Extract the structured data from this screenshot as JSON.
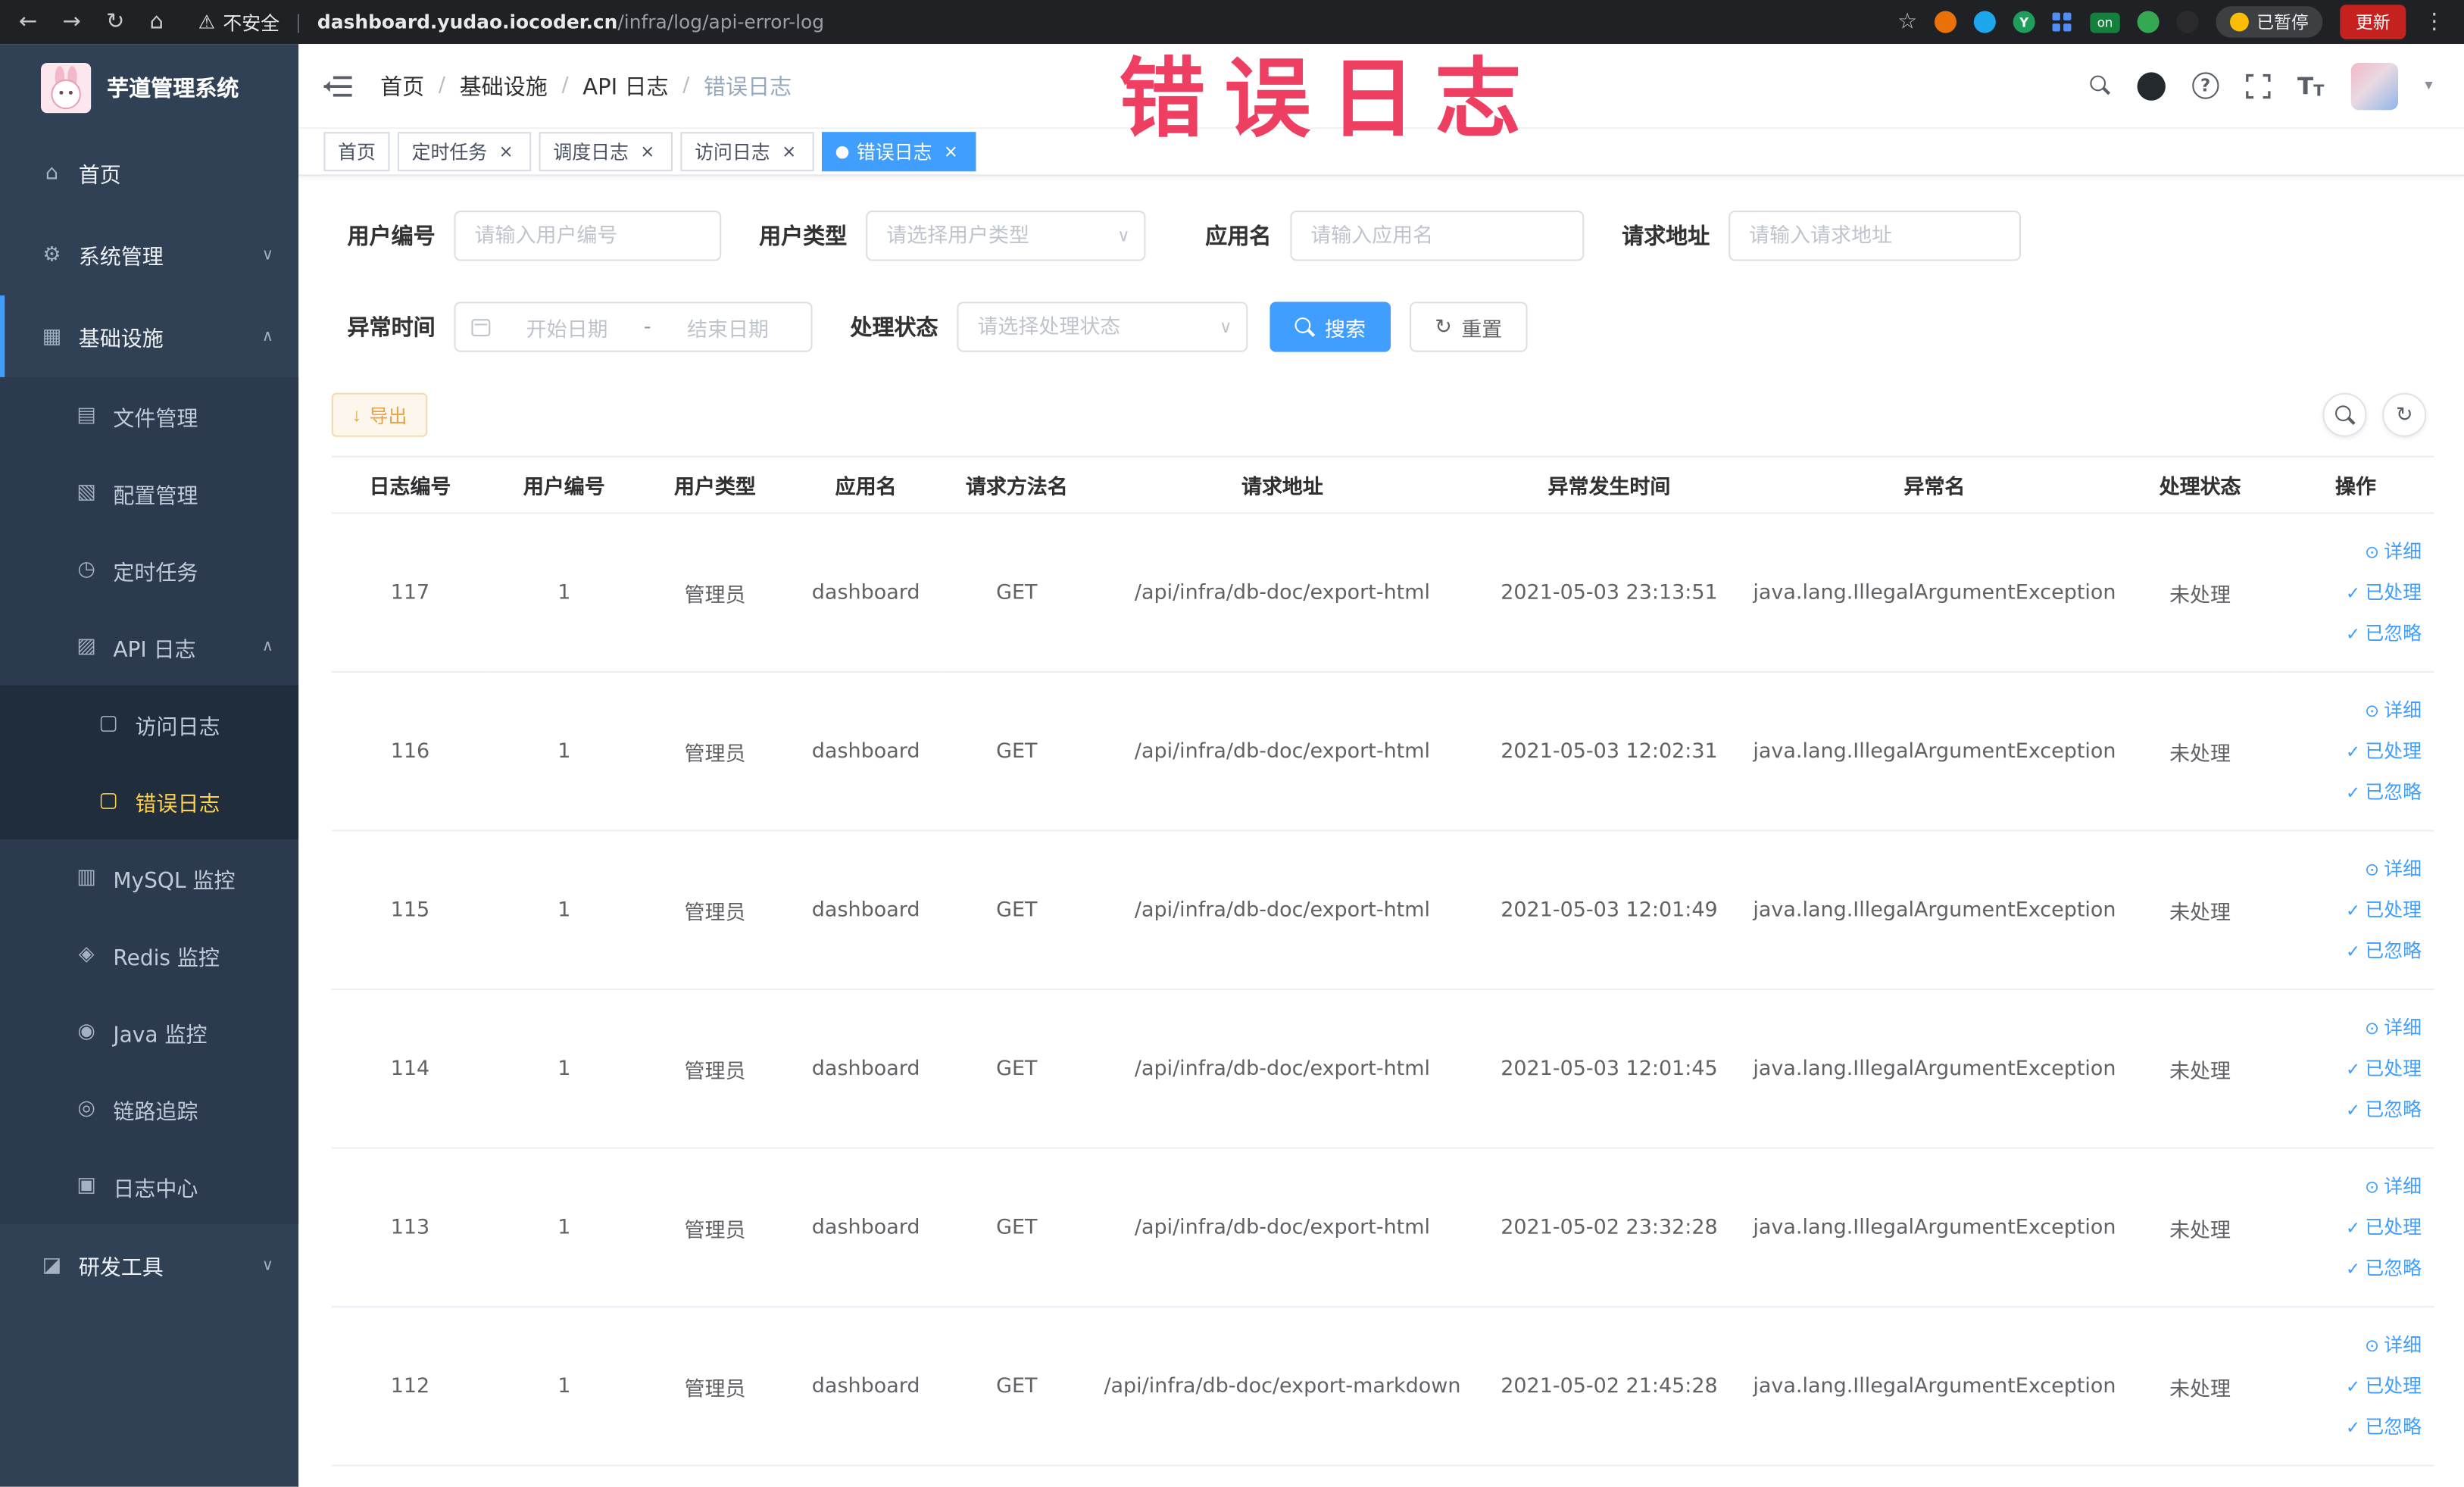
{
  "colors": {
    "accent": "#409eff",
    "sidebar_bg": "#304156",
    "sidebar_submenu_bg": "#1f2d3d",
    "active_menu_text": "#ffd04b",
    "annotation_pink": "#ee3f63",
    "export_text": "#e6a23c",
    "link_blue": "#409eff",
    "active_tab_bg": "#409eff"
  },
  "browser": {
    "security_label": "不安全",
    "separator": "|",
    "url_host": "dashboard.yudao.iocoder.cn",
    "url_path": "/infra/log/api-error-log",
    "paused_badge": "已暂停",
    "update_button": "更新"
  },
  "annotation": {
    "text": "错误日志"
  },
  "sidebar": {
    "logo_title": "芋道管理系统",
    "items": [
      {
        "key": "home",
        "label": "首页",
        "icon": "home-icon",
        "level": 0
      },
      {
        "key": "system-mgmt",
        "label": "系统管理",
        "icon": "gear-icon",
        "level": 0,
        "arrow": "down"
      },
      {
        "key": "infrastructure",
        "label": "基础设施",
        "icon": "infra-icon",
        "level": 0,
        "arrow": "up",
        "section_active": true
      },
      {
        "key": "file-mgmt",
        "label": "文件管理",
        "icon": "file-icon",
        "level": 1
      },
      {
        "key": "config-mgmt",
        "label": "配置管理",
        "icon": "config-icon",
        "level": 1
      },
      {
        "key": "scheduled-jobs",
        "label": "定时任务",
        "icon": "timer-icon",
        "level": 1
      },
      {
        "key": "api-logs",
        "label": "API 日志",
        "icon": "api-log-icon",
        "level": 1,
        "arrow": "up"
      },
      {
        "key": "access-log",
        "label": "访问日志",
        "icon": "doc-icon",
        "level": 2
      },
      {
        "key": "error-log",
        "label": "错误日志",
        "icon": "doc-icon",
        "level": 2,
        "active": true
      },
      {
        "key": "mysql-monitor",
        "label": "MySQL 监控",
        "icon": "mysql-icon",
        "level": 1
      },
      {
        "key": "redis-monitor",
        "label": "Redis 监控",
        "icon": "redis-icon",
        "level": 1
      },
      {
        "key": "java-monitor",
        "label": "Java 监控",
        "icon": "java-icon",
        "level": 1
      },
      {
        "key": "link-trace",
        "label": "链路追踪",
        "icon": "trace-icon",
        "level": 1
      },
      {
        "key": "log-center",
        "label": "日志中心",
        "icon": "log-center-icon",
        "level": 1
      },
      {
        "key": "dev-tools",
        "label": "研发工具",
        "icon": "tools-icon",
        "level": 0,
        "arrow": "down"
      }
    ]
  },
  "breadcrumb": [
    "首页",
    "基础设施",
    "API 日志",
    "错误日志"
  ],
  "breadcrumb_separator": "/",
  "tab_close_glyph": "×",
  "tabs": [
    {
      "label": "首页",
      "closable": false,
      "active": false
    },
    {
      "label": "定时任务",
      "closable": true,
      "active": false
    },
    {
      "label": "调度日志",
      "closable": true,
      "active": false
    },
    {
      "label": "访问日志",
      "closable": true,
      "active": false
    },
    {
      "label": "错误日志",
      "closable": true,
      "active": true
    }
  ],
  "filters": {
    "user_id": {
      "label": "用户编号",
      "placeholder": "请输入用户编号"
    },
    "user_type": {
      "label": "用户类型",
      "placeholder": "请选择用户类型"
    },
    "app_name": {
      "label": "应用名",
      "placeholder": "请输入应用名"
    },
    "request_url": {
      "label": "请求地址",
      "placeholder": "请输入请求地址"
    },
    "exception_time": {
      "label": "异常时间",
      "start_placeholder": "开始日期",
      "separator": "-",
      "end_placeholder": "结束日期"
    },
    "process_status": {
      "label": "处理状态",
      "placeholder": "请选择处理状态"
    },
    "search_button": "搜索",
    "reset_button": "重置"
  },
  "toolbar": {
    "export_button": "导出"
  },
  "table": {
    "columns": [
      "日志编号",
      "用户编号",
      "用户类型",
      "应用名",
      "请求方法名",
      "请求地址",
      "异常发生时间",
      "异常名",
      "处理状态",
      "操作"
    ],
    "field_order": [
      "id",
      "user_id",
      "user_type",
      "app",
      "method",
      "url",
      "time",
      "exception",
      "status"
    ],
    "rows": [
      {
        "id": "117",
        "user_id": "1",
        "user_type": "管理员",
        "app": "dashboard",
        "method": "GET",
        "url": "/api/infra/db-doc/export-html",
        "time": "2021-05-03 23:13:51",
        "exception": "java.lang.IllegalArgumentException",
        "status": "未处理"
      },
      {
        "id": "116",
        "user_id": "1",
        "user_type": "管理员",
        "app": "dashboard",
        "method": "GET",
        "url": "/api/infra/db-doc/export-html",
        "time": "2021-05-03 12:02:31",
        "exception": "java.lang.IllegalArgumentException",
        "status": "未处理"
      },
      {
        "id": "115",
        "user_id": "1",
        "user_type": "管理员",
        "app": "dashboard",
        "method": "GET",
        "url": "/api/infra/db-doc/export-html",
        "time": "2021-05-03 12:01:49",
        "exception": "java.lang.IllegalArgumentException",
        "status": "未处理"
      },
      {
        "id": "114",
        "user_id": "1",
        "user_type": "管理员",
        "app": "dashboard",
        "method": "GET",
        "url": "/api/infra/db-doc/export-html",
        "time": "2021-05-03 12:01:45",
        "exception": "java.lang.IllegalArgumentException",
        "status": "未处理"
      },
      {
        "id": "113",
        "user_id": "1",
        "user_type": "管理员",
        "app": "dashboard",
        "method": "GET",
        "url": "/api/infra/db-doc/export-html",
        "time": "2021-05-02 23:32:28",
        "exception": "java.lang.IllegalArgumentException",
        "status": "未处理"
      },
      {
        "id": "112",
        "user_id": "1",
        "user_type": "管理员",
        "app": "dashboard",
        "method": "GET",
        "url": "/api/infra/db-doc/export-markdown",
        "time": "2021-05-02 21:45:28",
        "exception": "java.lang.IllegalArgumentException",
        "status": "未处理"
      }
    ],
    "actions": [
      {
        "key": "detail",
        "label": "详细",
        "icon": "eye-icon"
      },
      {
        "key": "processed",
        "label": "已处理",
        "icon": "check-icon"
      },
      {
        "key": "ignored",
        "label": "已忽略",
        "icon": "check-icon"
      }
    ]
  },
  "icon_glyphs": {
    "back": "←",
    "forward": "→",
    "refresh": "↻",
    "home": "⌂",
    "warning": "⚠",
    "star": "☆",
    "more": "⋮",
    "home-icon": "⌂",
    "gear-icon": "⚙",
    "infra-icon": "▦",
    "file-icon": "▤",
    "config-icon": "▧",
    "timer-icon": "◷",
    "api-log-icon": "▨",
    "doc-icon": "▢",
    "mysql-icon": "▥",
    "redis-icon": "◈",
    "java-icon": "◉",
    "trace-icon": "◎",
    "log-center-icon": "▣",
    "tools-icon": "◪",
    "chevron-up": "∧",
    "chevron-down": "∨",
    "eye-icon": "⊙",
    "check-icon": "✓",
    "caret-down": "▾",
    "select-caret": "∨",
    "refresh-small": "↻",
    "download": "↓",
    "on-badge": "on",
    "extension-y": "Y",
    "help": "?",
    "font-size": "T"
  }
}
